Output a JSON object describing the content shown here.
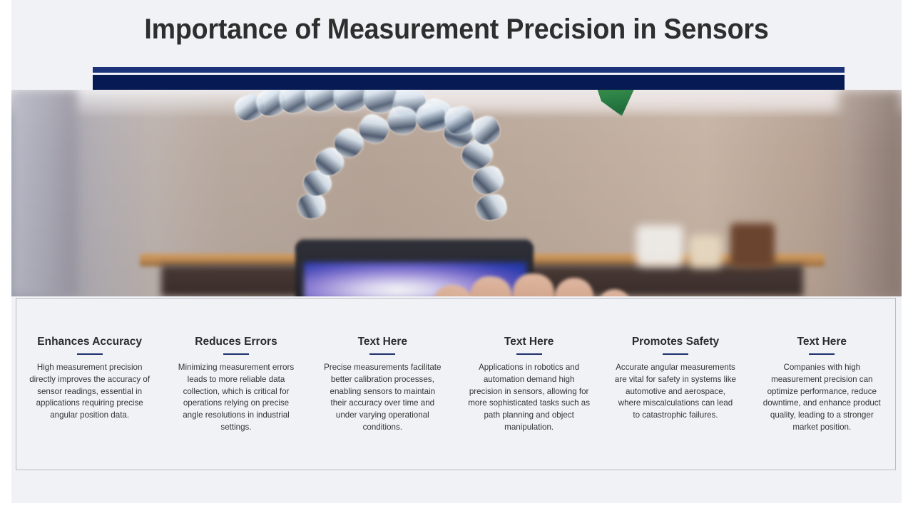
{
  "slide": {
    "title": "Importance of Measurement Precision in Sensors",
    "accent_color_light": "#1c3279",
    "accent_color_dark": "#081a54",
    "background_color": "#f1f2f6",
    "title_color": "#2e2e2e"
  },
  "photo": {
    "alt": "Close-up of a clear dental aligner held in front of a blurred laptop screen",
    "subjects": [
      "clear-dental-aligner",
      "laptop-screen",
      "hand-fingers",
      "green-leaf",
      "wooden-shelf",
      "storage-jars"
    ]
  },
  "cards": [
    {
      "title": "Enhances Accuracy",
      "body": "High measurement precision directly improves the accuracy of sensor readings, essential in applications requiring precise angular position data."
    },
    {
      "title": "Reduces Errors",
      "body": "Minimizing measurement errors leads to more reliable data collection, which is critical for operations relying on precise angle resolutions in industrial settings."
    },
    {
      "title": "Text Here",
      "body": "Precise measurements facilitate better calibration processes, enabling sensors to maintain their accuracy over time and under varying operational conditions."
    },
    {
      "title": "Text Here",
      "body": "Applications in robotics and automation demand high precision in sensors, allowing for more sophisticated tasks such as path planning and object manipulation."
    },
    {
      "title": "Promotes Safety",
      "body": "Accurate angular measurements are vital for safety in systems like automotive and aerospace, where miscalculations can lead to catastrophic failures."
    },
    {
      "title": "Text Here",
      "body": "Companies with high measurement precision can optimize performance, reduce downtime, and enhance product quality, leading to a stronger market position."
    }
  ]
}
